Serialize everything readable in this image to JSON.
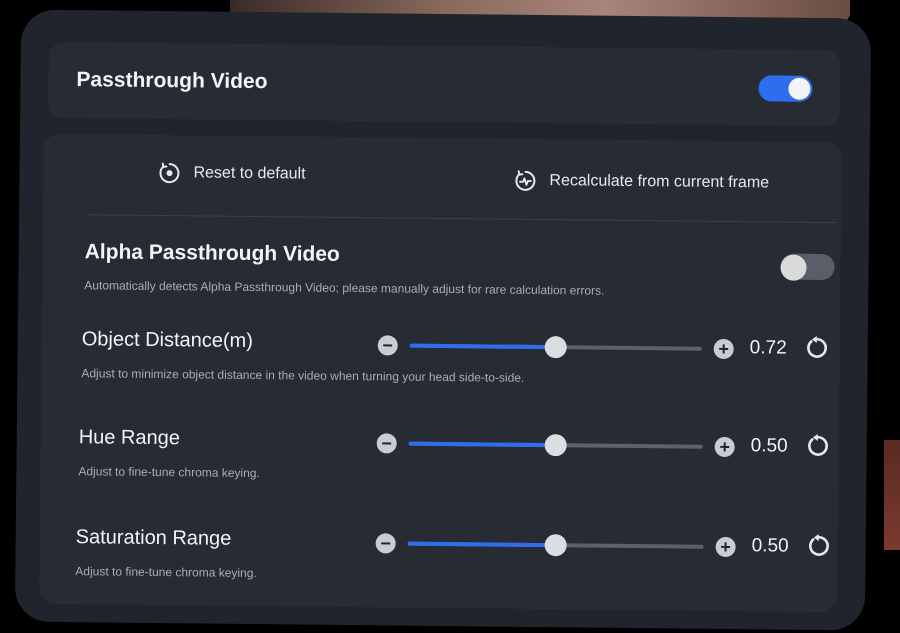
{
  "passthrough": {
    "title": "Passthrough Video",
    "enabled": true
  },
  "actions": {
    "reset_label": "Reset to default",
    "reset_icon": "reset-target-icon",
    "recalc_label": "Recalculate from current frame",
    "recalc_icon": "pulse-refresh-icon"
  },
  "alpha": {
    "title": "Alpha Passthrough Video",
    "description": "Automatically detects Alpha Passthrough Video; please manually adjust for rare calculation errors.",
    "enabled": false
  },
  "sliders": [
    {
      "label": "Object Distance(m)",
      "description": "Adjust to minimize object distance in the video when turning your head side-to-side.",
      "value_text": "0.72",
      "fill_fraction": 0.5
    },
    {
      "label": "Hue Range",
      "description": "Adjust to fine-tune chroma keying.",
      "value_text": "0.50",
      "fill_fraction": 0.5
    },
    {
      "label": "Saturation Range",
      "description": "Adjust to fine-tune chroma keying.",
      "value_text": "0.50",
      "fill_fraction": 0.5
    }
  ],
  "colors": {
    "accent": "#2f6df0",
    "panel": "#20252d",
    "card": "#262b34"
  }
}
